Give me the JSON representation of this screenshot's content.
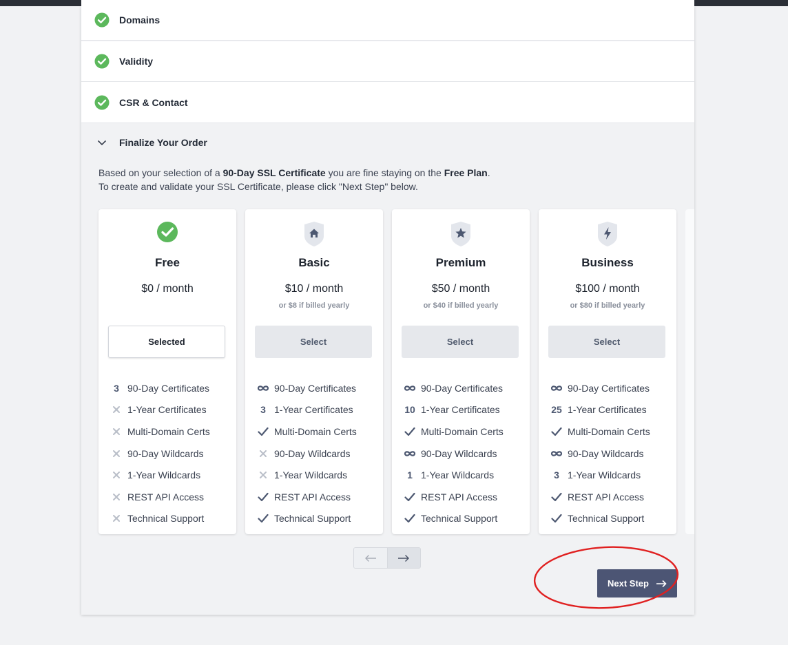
{
  "steps": [
    {
      "label": "Domains"
    },
    {
      "label": "Validity"
    },
    {
      "label": "CSR & Contact"
    }
  ],
  "finalize": {
    "title": "Finalize Your Order",
    "intro_prefix": "Based on your selection of a ",
    "intro_bold1": "90-Day SSL Certificate",
    "intro_mid": " you are fine staying on the ",
    "intro_bold2": "Free Plan",
    "intro_suffix": ".",
    "intro_line2": "To create and validate your SSL Certificate, please click \"Next Step\" below."
  },
  "plans": [
    {
      "name": "Free",
      "price": "$0 / month",
      "yearly": "",
      "button": "Selected",
      "icon": "green-check-icon",
      "features": [
        {
          "icon": "3",
          "label": "90-Day Certificates"
        },
        {
          "icon": "x",
          "label": "1-Year Certificates"
        },
        {
          "icon": "x",
          "label": "Multi-Domain Certs"
        },
        {
          "icon": "x",
          "label": "90-Day Wildcards"
        },
        {
          "icon": "x",
          "label": "1-Year Wildcards"
        },
        {
          "icon": "x",
          "label": "REST API Access"
        },
        {
          "icon": "x",
          "label": "Technical Support"
        }
      ]
    },
    {
      "name": "Basic",
      "price": "$10 / month",
      "yearly": "or $8 if billed yearly",
      "button": "Select",
      "icon": "home-shield-icon",
      "features": [
        {
          "icon": "inf",
          "label": "90-Day Certificates"
        },
        {
          "icon": "3",
          "label": "1-Year Certificates"
        },
        {
          "icon": "check",
          "label": "Multi-Domain Certs"
        },
        {
          "icon": "x",
          "label": "90-Day Wildcards"
        },
        {
          "icon": "x",
          "label": "1-Year Wildcards"
        },
        {
          "icon": "check",
          "label": "REST API Access"
        },
        {
          "icon": "check",
          "label": "Technical Support"
        }
      ]
    },
    {
      "name": "Premium",
      "price": "$50 / month",
      "yearly": "or $40 if billed yearly",
      "button": "Select",
      "icon": "star-shield-icon",
      "features": [
        {
          "icon": "inf",
          "label": "90-Day Certificates"
        },
        {
          "icon": "10",
          "label": "1-Year Certificates"
        },
        {
          "icon": "check",
          "label": "Multi-Domain Certs"
        },
        {
          "icon": "inf",
          "label": "90-Day Wildcards"
        },
        {
          "icon": "1",
          "label": "1-Year Wildcards"
        },
        {
          "icon": "check",
          "label": "REST API Access"
        },
        {
          "icon": "check",
          "label": "Technical Support"
        }
      ]
    },
    {
      "name": "Business",
      "price": "$100 / month",
      "yearly": "or $80 if billed yearly",
      "button": "Select",
      "icon": "bolt-shield-icon",
      "features": [
        {
          "icon": "inf",
          "label": "90-Day Certificates"
        },
        {
          "icon": "25",
          "label": "1-Year Certificates"
        },
        {
          "icon": "check",
          "label": "Multi-Domain Certs"
        },
        {
          "icon": "inf",
          "label": "90-Day Wildcards"
        },
        {
          "icon": "3",
          "label": "1-Year Wildcards"
        },
        {
          "icon": "check",
          "label": "REST API Access"
        },
        {
          "icon": "check",
          "label": "Technical Support"
        }
      ]
    }
  ],
  "next_step_label": "Next Step",
  "colors": {
    "accent": "#4c5574",
    "success": "#5cb85c",
    "annotation": "#e02020"
  }
}
